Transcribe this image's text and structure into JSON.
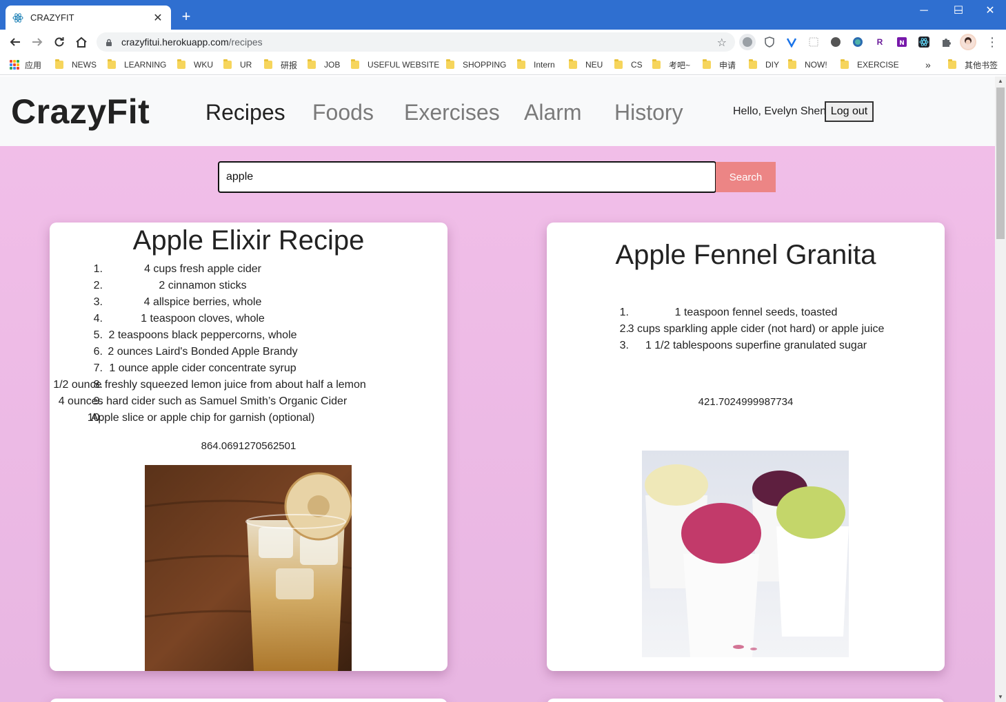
{
  "browser": {
    "tab_title": "CRAZYFIT",
    "url_host": "crazyfitui.herokuapp.com",
    "url_path": "/recipes",
    "bookmarks": [
      "应用",
      "NEWS",
      "LEARNING",
      "WKU",
      "UR",
      "研报",
      "JOB",
      "USEFUL WEBSITE",
      "SHOPPING",
      "Intern",
      "NEU",
      "CS",
      "考吧~",
      "申请",
      "DIY",
      "NOW!",
      "EXERCISE"
    ],
    "other_bookmarks": "其他书签",
    "overflow_chevron": "»"
  },
  "navbar": {
    "brand": "CrazyFit",
    "links": [
      "Recipes",
      "Foods",
      "Exercises",
      "Alarm",
      "History"
    ],
    "active_link": "Recipes",
    "greeting": "Hello, Evelyn Shen",
    "logout_label": "Log out"
  },
  "search": {
    "value": "apple",
    "button_label": "Search"
  },
  "recipes": [
    {
      "title": "Apple Elixir Recipe",
      "ingredients": [
        "4 cups fresh apple cider",
        "2 cinnamon sticks",
        "4 allspice berries, whole",
        "1 teaspoon cloves, whole",
        "2 teaspoons black peppercorns, whole",
        "2 ounces Laird's Bonded Apple Brandy",
        "1 ounce apple cider concentrate syrup",
        "1/2 ounce freshly squeezed lemon juice from about half a lemon",
        "4 ounces hard cider such as Samuel Smith’s Organic Cider",
        "Apple slice or apple chip for garnish (optional)"
      ],
      "calories": "864.0691270562501"
    },
    {
      "title": "Apple Fennel Granita",
      "ingredients": [
        "1 teaspoon fennel seeds, toasted",
        "3 cups sparkling apple cider (not hard) or apple juice",
        "1 1/2 tablespoons superfine granulated sugar"
      ],
      "calories": "421.7024999987734"
    }
  ],
  "colors": {
    "page_gradient_top": "#f2bfe9",
    "search_button": "#ec8585",
    "browser_titlebar": "#2f6fd0"
  }
}
